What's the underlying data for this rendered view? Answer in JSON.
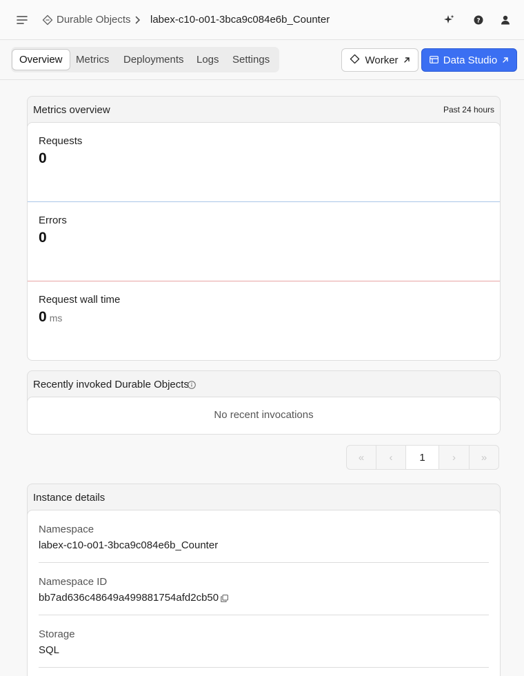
{
  "header": {
    "breadcrumb_parent": "Durable Objects",
    "breadcrumb_current": "labex-c10-o01-3bca9c084e6b_Counter",
    "icons": [
      "menu-icon",
      "durable-objects-icon",
      "chevron-right-icon",
      "sparkle-icon",
      "help-icon",
      "user-icon"
    ]
  },
  "tabs": [
    {
      "label": "Overview",
      "active": true
    },
    {
      "label": "Metrics",
      "active": false
    },
    {
      "label": "Deployments",
      "active": false
    },
    {
      "label": "Logs",
      "active": false
    },
    {
      "label": "Settings",
      "active": false
    }
  ],
  "actions": {
    "worker_label": "Worker",
    "studio_label": "Data Studio"
  },
  "metrics": {
    "title": "Metrics overview",
    "range": "Past 24 hours",
    "items": [
      {
        "label": "Requests",
        "value": "0",
        "unit": "",
        "line_color": "#a9c6e8"
      },
      {
        "label": "Errors",
        "value": "0",
        "unit": "",
        "line_color": "#e8a3a3"
      },
      {
        "label": "Request wall time",
        "value": "0",
        "unit": "ms",
        "line_color": "#a9b8e6"
      }
    ]
  },
  "recent": {
    "title": "Recently invoked Durable Objects",
    "empty": "No recent invocations"
  },
  "pagination": {
    "first": "«",
    "prev": "‹",
    "page": "1",
    "next": "›",
    "last": "»"
  },
  "details": {
    "title": "Instance details",
    "items": [
      {
        "label": "Namespace",
        "value": "labex-c10-o01-3bca9c084e6b_Counter"
      },
      {
        "label": "Namespace ID",
        "value": "bb7ad636c48649a499881754afd2cb50"
      },
      {
        "label": "Storage",
        "value": "SQL"
      }
    ]
  },
  "colors": {
    "accent": "#3b6ff2"
  }
}
